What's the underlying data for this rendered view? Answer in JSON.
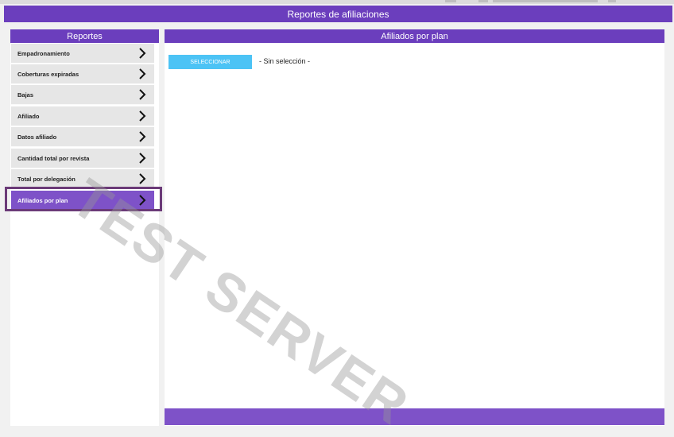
{
  "window": {
    "title": "Reportes de afiliaciones"
  },
  "sidebar": {
    "header": "Reportes",
    "items": [
      {
        "label": "Empadronamiento",
        "active": false
      },
      {
        "label": "Coberturas expiradas",
        "active": false
      },
      {
        "label": "Bajas",
        "active": false
      },
      {
        "label": "Afiliado",
        "active": false
      },
      {
        "label": "Datos afiliado",
        "active": false
      },
      {
        "label": "Cantidad total por revista",
        "active": false
      },
      {
        "label": "Total por delegación",
        "active": false
      },
      {
        "label": "Afiliados por plan",
        "active": true
      }
    ]
  },
  "main": {
    "header": "Afiliados por plan",
    "select_button": "SELECCIONAR",
    "selection_status": "- Sin selección -"
  },
  "watermark": "TEST SERVER",
  "colors": {
    "header_purple": "#6b3ebd",
    "active_purple": "#7e52c8",
    "select_button": "#4cc3f5",
    "highlight_border": "#6b3a78"
  },
  "icons": {
    "menu_chevron": "chevron-right-icon"
  }
}
